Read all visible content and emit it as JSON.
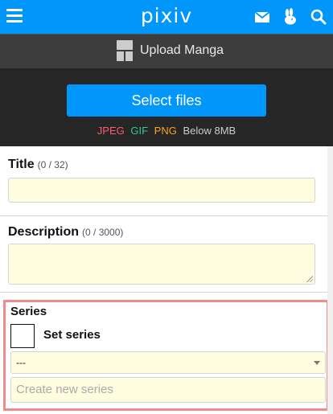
{
  "header": {
    "logo": "pixiv",
    "icons": [
      "menu-icon",
      "mail-icon",
      "rabbit-icon",
      "search-icon"
    ]
  },
  "upload": {
    "heading": "Upload Manga",
    "select_files_label": "Select files",
    "formats": {
      "jpeg": "JPEG",
      "gif": "GIF",
      "png": "PNG",
      "limit": "Below 8MB"
    },
    "format_colors": {
      "jpeg": "#ff5a6e",
      "gif": "#2ec98f",
      "png": "#f5a623"
    }
  },
  "title_field": {
    "label": "Title",
    "count": "(0 / 32)",
    "value": ""
  },
  "description_field": {
    "label": "Description",
    "count": "(0 / 3000)",
    "value": ""
  },
  "series": {
    "label": "Series",
    "checkbox_label": "Set series",
    "checked": false,
    "selected_option": "---",
    "new_series_placeholder": "Create new series"
  },
  "colors": {
    "accent": "#0096fa",
    "dark_header": "#3d3d3d",
    "dark_body": "#262626",
    "input_bg": "#fffde0",
    "highlight_border": "#f08a8d"
  }
}
